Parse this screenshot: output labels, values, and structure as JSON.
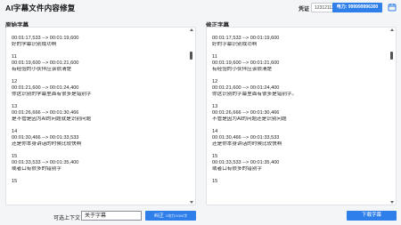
{
  "app": {
    "title": "AI字幕文件内容修复"
  },
  "header": {
    "credential_label": "凭证",
    "credential_value": "123121123",
    "power_label": "电力: 999999996300",
    "calendar_icon": "calendar-icon"
  },
  "left_panel": {
    "title": "原始字幕",
    "entries": [
      {
        "idx": "",
        "time": "00:01:17,533 --> 00:01:19,600",
        "text": "好的学幕识别成功啊"
      },
      {
        "idx": "11",
        "time": "00:01:19,600 --> 00:01:21,600",
        "text": "有经验的小伙伴应该很清楚"
      },
      {
        "idx": "12",
        "time": "00:01:21,600 --> 00:01:24,400",
        "text": "你这识别的学幕里面有很多是错别字"
      },
      {
        "idx": "13",
        "time": "00:01:26,666 --> 00:01:30,466",
        "text": "是不管是因为AI的问题就是识别问题"
      },
      {
        "idx": "14",
        "time": "00:01:30,466 --> 00:01:33,533",
        "text": "还是你本身讲话的时候比较快啊"
      },
      {
        "idx": "15",
        "time": "00:01:33,533 --> 00:01:35,400",
        "text": "或者口有很多的错别字"
      },
      {
        "idx": "15",
        "time": "",
        "text": ""
      }
    ]
  },
  "right_panel": {
    "title": "修正字幕",
    "entries": [
      {
        "idx": "",
        "time": "00:01:17,533 --> 00:01:19,600",
        "text": "好的字幕识别成功啊"
      },
      {
        "idx": "11",
        "time": "00:01:19,600 --> 00:01:21,600",
        "text": "有经验的小伙伴应该很清楚"
      },
      {
        "idx": "12",
        "time": "00:01:21,600 --> 00:01:24,400",
        "text": "你这识别的字幕里面有很多是错别字。"
      },
      {
        "idx": "13",
        "time": "00:01:26,666 --> 00:01:30,466",
        "text": "不管是因为AI的问题还是识别问题"
      },
      {
        "idx": "14",
        "time": "00:01:30,466 --> 00:01:33,533",
        "text": "还是你本身讲话的时候比较快啊"
      },
      {
        "idx": "15",
        "time": "00:01:33,533 --> 00:01:35,400",
        "text": "或者口有很多的错别字"
      },
      {
        "idx": "15",
        "time": "",
        "text": ""
      }
    ]
  },
  "footer": {
    "context_label": "可选上下文",
    "context_value": "关于字幕",
    "correct_label": "纠正",
    "correct_badge": "1电力/1000字",
    "download_label": "下载字幕"
  },
  "colors": {
    "accent": "#2f7fea",
    "background": "#f4f5f7",
    "panel": "#ffffff"
  }
}
